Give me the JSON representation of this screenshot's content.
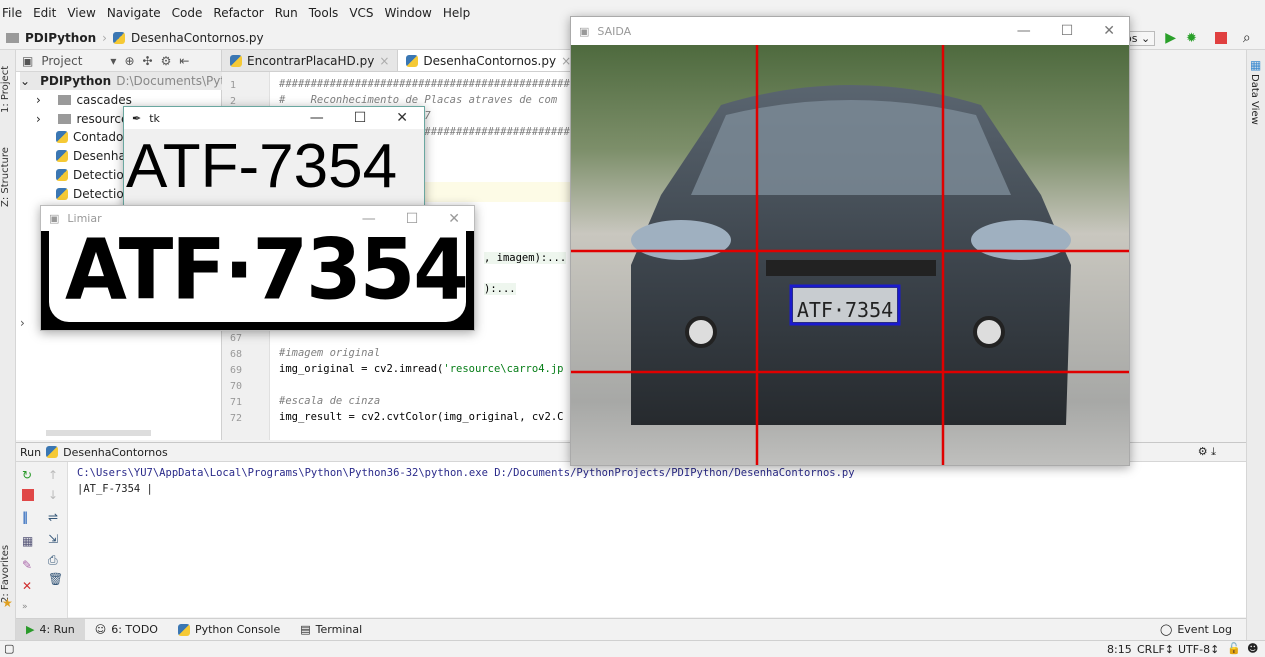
{
  "menu": [
    "File",
    "Edit",
    "View",
    "Navigate",
    "Code",
    "Refactor",
    "Run",
    "Tools",
    "VCS",
    "Window",
    "Help"
  ],
  "breadcrumb": {
    "project": "PDIPython",
    "file": "DesenhaContornos.py"
  },
  "toolbar": {
    "run_config": "os"
  },
  "left_strip": {
    "project": "1: Project",
    "structure": "Z: Structure",
    "favorites": "2: Favorites"
  },
  "right_strip": {
    "data_view": "Data View"
  },
  "project_panel": {
    "title": "Project",
    "root": {
      "name": "PDIPython",
      "path": "D:\\Documents\\Pytho"
    },
    "items": [
      {
        "name": "cascades",
        "type": "folder"
      },
      {
        "name": "resource",
        "type": "folder"
      },
      {
        "name": "Contador.",
        "type": "python"
      },
      {
        "name": "DesenhaC",
        "type": "python"
      },
      {
        "name": "Detection(",
        "type": "python"
      },
      {
        "name": "DetectionF",
        "type": "python"
      }
    ]
  },
  "editor": {
    "tabs": [
      {
        "label": "EncontrarPlacaHD.py",
        "active": false
      },
      {
        "label": "DesenhaContornos.py",
        "active": true
      }
    ],
    "lines": [
      {
        "n": "1",
        "text": "##################################################",
        "cls": "cm"
      },
      {
        "n": "2",
        "text": "#    Reconhecimento de Placas atraves de com",
        "cls": "cm"
      },
      {
        "n": "",
        "text": "                  by AY7",
        "cls": "cm"
      },
      {
        "n": "",
        "text": "                ##################################",
        "cls": "cm"
      }
    ],
    "folded": [
      ", imagem):...",
      "):..."
    ],
    "lines_bottom": [
      {
        "n": "67",
        "text": ""
      },
      {
        "n": "68",
        "text": "#imagem original",
        "cls": "cm"
      },
      {
        "n": "69",
        "text": "img_original = cv2.imread(",
        "str": "'resource\\carro4.jp"
      },
      {
        "n": "70",
        "text": ""
      },
      {
        "n": "71",
        "text": "#escala de cinza",
        "cls": "cm"
      },
      {
        "n": "72",
        "text": "img_result = cv2.cvtColor(img_original, cv2.C"
      }
    ]
  },
  "run_panel": {
    "label": "Run",
    "config": "DesenhaContornos",
    "output": [
      "C:\\Users\\YU7\\AppData\\Local\\Programs\\Python\\Python36-32\\python.exe D:/Documents/PythonProjects/PDIPython/DesenhaContornos.py",
      "|AT_F-7354 |"
    ]
  },
  "bottom_tabs": [
    {
      "label": "4: Run",
      "active": true
    },
    {
      "label": "6: TODO",
      "active": false
    },
    {
      "label": "Python Console",
      "active": false
    },
    {
      "label": "Terminal",
      "active": false
    }
  ],
  "event_log": "Event Log",
  "status": {
    "position": "8:15",
    "line_sep": "CRLF↕",
    "encoding": "UTF-8↕"
  },
  "windows": {
    "tk": {
      "title": "tk",
      "text": "ATF-7354"
    },
    "limiar": {
      "title": "Limiar",
      "plate": "ATF·7354"
    },
    "saida": {
      "title": "SAIDA",
      "plate": "ATF·7354",
      "line_color": "#e00000",
      "box_color": "#1a1acc"
    }
  }
}
